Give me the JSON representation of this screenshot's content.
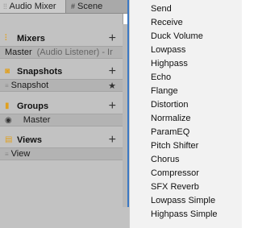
{
  "tabs": [
    {
      "label": "Audio Mixer",
      "icon": "mixer-sliders-icon"
    },
    {
      "label": "Scene",
      "icon": "grid-icon"
    }
  ],
  "sections": {
    "mixers": {
      "title": "Mixers",
      "rows": [
        {
          "name": "Master",
          "detail": "(Audio Listener) - Ir"
        }
      ]
    },
    "snapshots": {
      "title": "Snapshots",
      "rows": [
        {
          "name": "Snapshot"
        }
      ]
    },
    "groups": {
      "title": "Groups",
      "rows": [
        {
          "name": "Master"
        }
      ]
    },
    "views": {
      "title": "Views",
      "rows": [
        {
          "name": "View"
        }
      ]
    }
  },
  "menu": {
    "items": [
      "Send",
      "Receive",
      "Duck Volume",
      "Lowpass",
      "Highpass",
      "Echo",
      "Flange",
      "Distortion",
      "Normalize",
      "ParamEQ",
      "Pitch Shifter",
      "Chorus",
      "Compressor",
      "SFX Reverb",
      "Lowpass Simple",
      "Highpass Simple"
    ]
  },
  "colors": {
    "panel_bg": "#c2c2c2",
    "accent_blue": "#3b78c4",
    "icon_orange": "#e0a020",
    "menu_bg": "#f2f2f2"
  }
}
